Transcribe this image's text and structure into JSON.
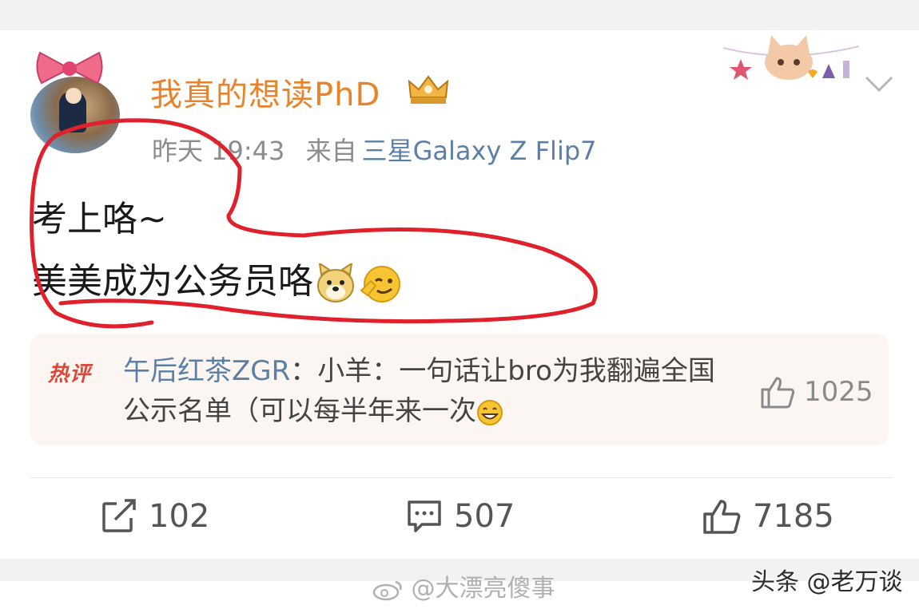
{
  "post": {
    "username": "我真的想读PhD",
    "time": "昨天 19:43",
    "from_label": "来自",
    "source": "三星Galaxy Z Flip7",
    "content_lines": [
      "考上咯~",
      "美美成为公务员咯"
    ],
    "emojis": [
      "doge-icon",
      "salute-face-icon"
    ]
  },
  "hot_comment": {
    "tag": "热评",
    "author": "午后红茶ZGR",
    "separator": "：",
    "text": "小羊：一句话让bro为我翻遍全国公示名单（可以每半年来一次",
    "emoji": "grin-face-icon",
    "likes": "1025"
  },
  "actions": {
    "repost_count": "102",
    "comment_count": "507",
    "like_count": "7185"
  },
  "watermarks": {
    "left": "@大漂亮傻事",
    "right": "头条 @老万谈"
  },
  "colors": {
    "username": "#e8832a",
    "source": "#5b7fa6",
    "annotation": "#e0202a",
    "hot_tag": "#d9483b"
  }
}
